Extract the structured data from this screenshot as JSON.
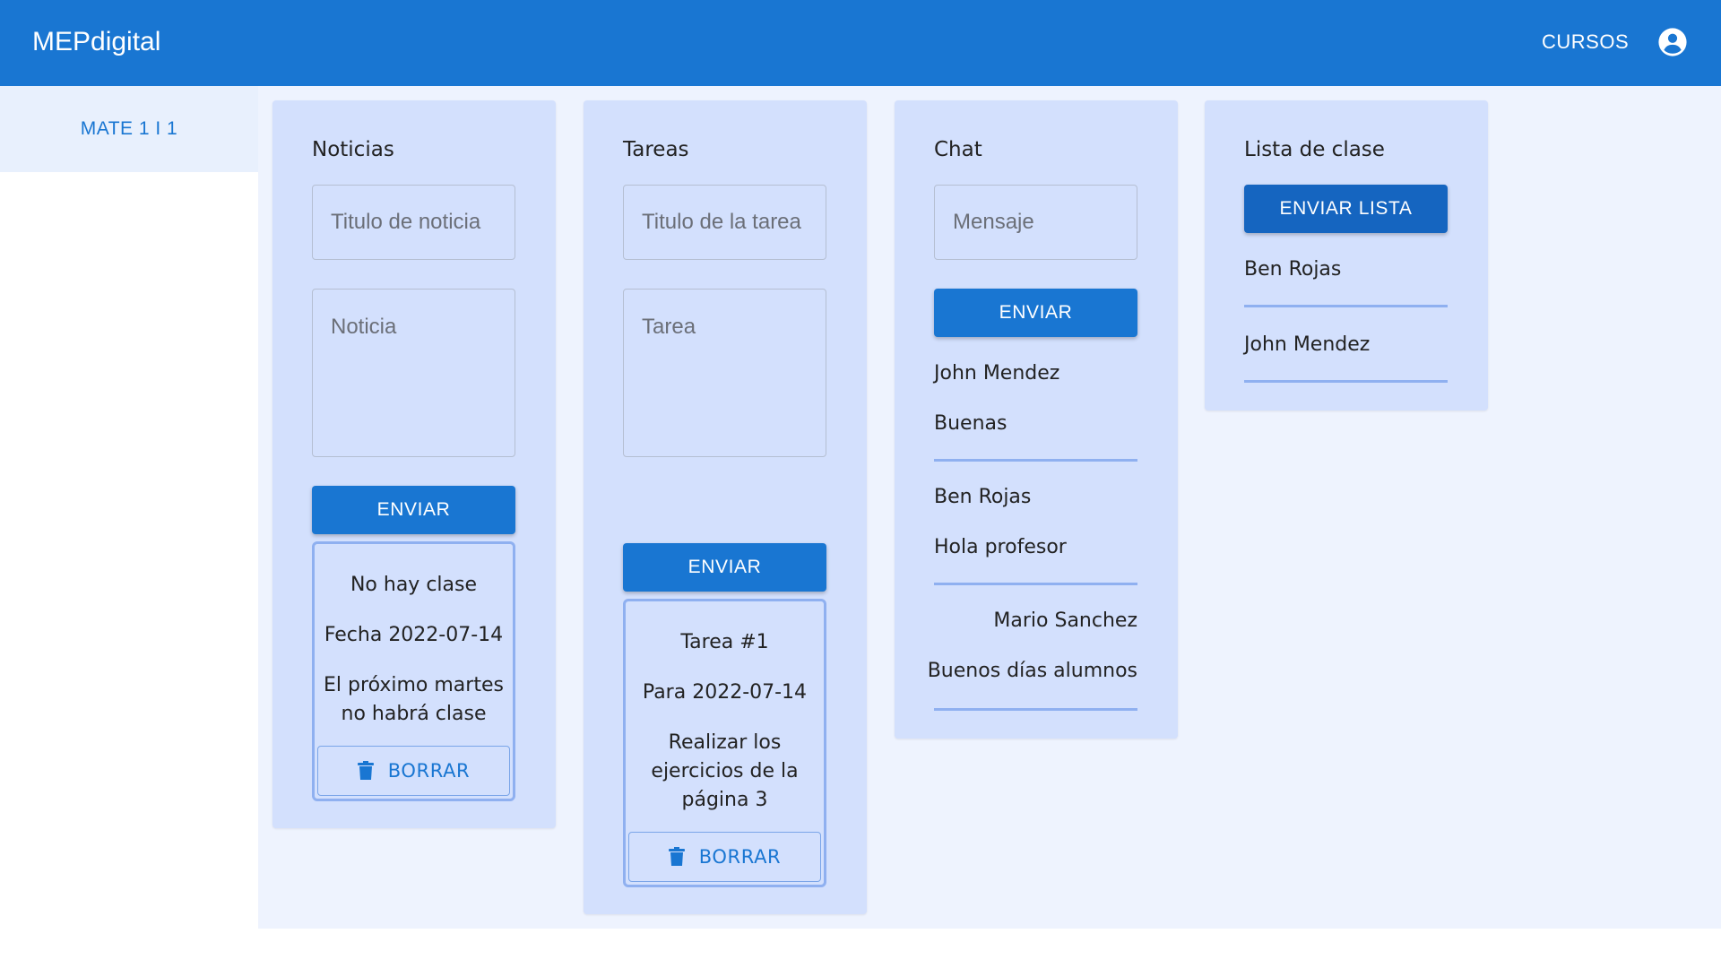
{
  "appbar": {
    "brand": "MEPdigital",
    "nav_cursos": "CURSOS"
  },
  "sidebar": {
    "items": [
      {
        "label": "MATE 1 I 1"
      }
    ]
  },
  "noticias": {
    "title": "Noticias",
    "title_placeholder": "Titulo de noticia",
    "body_placeholder": "Noticia",
    "send_label": "ENVIAR",
    "post": {
      "title": "No hay clase",
      "date": "Fecha 2022-07-14",
      "body_line1": "El próximo martes",
      "body_line2": "no habrá clase",
      "delete_label": "BORRAR"
    }
  },
  "tareas": {
    "title": "Tareas",
    "title_placeholder": "Titulo de la tarea",
    "body_placeholder": "Tarea",
    "send_label": "ENVIAR",
    "post": {
      "title": "Tarea #1",
      "date": "Para 2022-07-14",
      "body_line1": "Realizar los",
      "body_line2": "ejercicios de la",
      "body_line3": "página 3",
      "delete_label": "BORRAR"
    }
  },
  "chat": {
    "title": "Chat",
    "message_placeholder": "Mensaje",
    "send_label": "ENVIAR",
    "messages": [
      {
        "author": "John Mendez",
        "text": "Buenas"
      },
      {
        "author": "Ben Rojas",
        "text": "Hola profesor"
      },
      {
        "author": "Mario Sanchez",
        "text": "Buenos días alumnos"
      }
    ]
  },
  "lista": {
    "title": "Lista de clase",
    "send_label": "ENVIAR LISTA",
    "students": [
      {
        "name": "Ben Rojas"
      },
      {
        "name": "John Mendez"
      }
    ]
  },
  "colors": {
    "primary": "#1976d2",
    "card_bg": "#d3e0fd",
    "main_bg": "#eef3fe",
    "divider": "#8fb0f0"
  },
  "icons": {
    "account": "account-circle-icon",
    "delete": "trash-icon"
  }
}
